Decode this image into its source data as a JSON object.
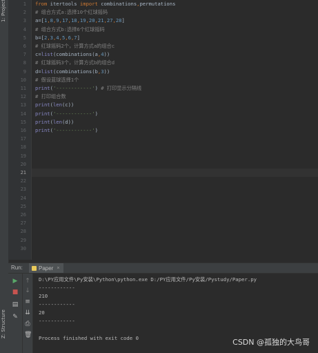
{
  "left_strip": {
    "project_tab": "1: Project",
    "structure_tab": "Z: Structure"
  },
  "editor": {
    "line_numbers": [
      "1",
      "2",
      "3",
      "4",
      "5",
      "6",
      "7",
      "8",
      "9",
      "10",
      "11",
      "12",
      "13",
      "14",
      "15",
      "16",
      "17",
      "18",
      "19",
      "20",
      "21",
      "22",
      "23",
      "24",
      "25",
      "26",
      "27",
      "28",
      "29",
      "30"
    ],
    "active_line": "21",
    "lines": [
      {
        "segments": [
          {
            "t": "from",
            "c": "kw"
          },
          {
            "t": " itertools ",
            "c": ""
          },
          {
            "t": "import",
            "c": "kw"
          },
          {
            "t": " combinations",
            "c": ""
          },
          {
            "t": ",",
            "c": "op"
          },
          {
            "t": "permutations",
            "c": ""
          }
        ]
      },
      {
        "segments": [
          {
            "t": "# 组合方式a:选择10个红球摇码",
            "c": "cm"
          }
        ]
      },
      {
        "segments": [
          {
            "t": "a=[",
            "c": ""
          },
          {
            "t": "1",
            "c": "num"
          },
          {
            "t": ",",
            "c": "op"
          },
          {
            "t": "8",
            "c": "num"
          },
          {
            "t": ",",
            "c": "op"
          },
          {
            "t": "9",
            "c": "num"
          },
          {
            "t": ",",
            "c": "op"
          },
          {
            "t": "17",
            "c": "num"
          },
          {
            "t": ",",
            "c": "op"
          },
          {
            "t": "18",
            "c": "num"
          },
          {
            "t": ",",
            "c": "op"
          },
          {
            "t": "19",
            "c": "num"
          },
          {
            "t": ",",
            "c": "op"
          },
          {
            "t": "20",
            "c": "num"
          },
          {
            "t": ",",
            "c": "op"
          },
          {
            "t": "21",
            "c": "num"
          },
          {
            "t": ",",
            "c": "op"
          },
          {
            "t": "27",
            "c": "num"
          },
          {
            "t": ",",
            "c": "op"
          },
          {
            "t": "28",
            "c": "num"
          },
          {
            "t": "]",
            "c": ""
          }
        ]
      },
      {
        "segments": [
          {
            "t": "# 组合方式b:选择6个红球摇码",
            "c": "cm"
          }
        ]
      },
      {
        "segments": [
          {
            "t": "b=[",
            "c": ""
          },
          {
            "t": "2",
            "c": "num"
          },
          {
            "t": ",",
            "c": "op"
          },
          {
            "t": "3",
            "c": "num"
          },
          {
            "t": ",",
            "c": "op"
          },
          {
            "t": "4",
            "c": "num"
          },
          {
            "t": ",",
            "c": "op"
          },
          {
            "t": "5",
            "c": "num"
          },
          {
            "t": ",",
            "c": "op"
          },
          {
            "t": "6",
            "c": "num"
          },
          {
            "t": ",",
            "c": "op"
          },
          {
            "t": "7",
            "c": "num"
          },
          {
            "t": "]",
            "c": ""
          }
        ]
      },
      {
        "segments": [
          {
            "t": "# 红球摇码2个，计算方式a的组合c",
            "c": "cm"
          }
        ]
      },
      {
        "segments": [
          {
            "t": "c=",
            "c": ""
          },
          {
            "t": "list",
            "c": "bi"
          },
          {
            "t": "(combinations(a",
            "c": ""
          },
          {
            "t": ",",
            "c": "op"
          },
          {
            "t": "4",
            "c": "num"
          },
          {
            "t": "))",
            "c": ""
          }
        ]
      },
      {
        "segments": [
          {
            "t": "# 红球摇码3个，计算方式b的组合d",
            "c": "cm"
          }
        ]
      },
      {
        "segments": [
          {
            "t": "d=",
            "c": ""
          },
          {
            "t": "list",
            "c": "bi"
          },
          {
            "t": "(combinations(b",
            "c": ""
          },
          {
            "t": ",",
            "c": "op"
          },
          {
            "t": "3",
            "c": "num"
          },
          {
            "t": "))",
            "c": ""
          }
        ]
      },
      {
        "segments": [
          {
            "t": "# 假设蓝球选择1个",
            "c": "cm"
          }
        ]
      },
      {
        "segments": [
          {
            "t": "print",
            "c": "bi"
          },
          {
            "t": "(",
            "c": ""
          },
          {
            "t": "'------------'",
            "c": "str"
          },
          {
            "t": ")",
            "c": ""
          },
          {
            "t": " # 打印显示分隔线",
            "c": "cm"
          }
        ]
      },
      {
        "segments": [
          {
            "t": "# 打印组合数",
            "c": "cm"
          }
        ]
      },
      {
        "segments": [
          {
            "t": "print",
            "c": "bi"
          },
          {
            "t": "(",
            "c": ""
          },
          {
            "t": "len",
            "c": "bi"
          },
          {
            "t": "(c))",
            "c": ""
          }
        ]
      },
      {
        "segments": [
          {
            "t": "print",
            "c": "bi"
          },
          {
            "t": "(",
            "c": ""
          },
          {
            "t": "'------------'",
            "c": "str"
          },
          {
            "t": ")",
            "c": ""
          }
        ]
      },
      {
        "segments": [
          {
            "t": "print",
            "c": "bi"
          },
          {
            "t": "(",
            "c": ""
          },
          {
            "t": "len",
            "c": "bi"
          },
          {
            "t": "(d))",
            "c": ""
          }
        ]
      },
      {
        "segments": [
          {
            "t": "print",
            "c": "bi"
          },
          {
            "t": "(",
            "c": ""
          },
          {
            "t": "'------------'",
            "c": "str"
          },
          {
            "t": ")",
            "c": ""
          }
        ]
      }
    ],
    "colors": {
      "keyword": "#cc7832",
      "comment": "#808080",
      "number": "#6897bb",
      "string": "#6a8759",
      "builtin": "#8888c6"
    }
  },
  "run_panel": {
    "run_label": "Run:",
    "tab_label": "Paper",
    "tab_close": "×",
    "console_lines": [
      "D:\\PY应用文件\\Py安装\\Python\\python.exe D:/PY应用文件/Py安装/Pystudy/Paper.py",
      "------------",
      "210",
      "------------",
      "20",
      "------------",
      "",
      "Process finished with exit code 0"
    ],
    "tool_icons": [
      "run-icon",
      "stop-icon",
      "layout-icon",
      "pin-icon"
    ],
    "tool_icons2": [
      "scroll-up-icon",
      "scroll-down-icon",
      "wrap-icon",
      "scroll-end-icon",
      "print-icon",
      "trash-icon"
    ]
  },
  "watermark": "CSDN @孤独的大鸟哥"
}
